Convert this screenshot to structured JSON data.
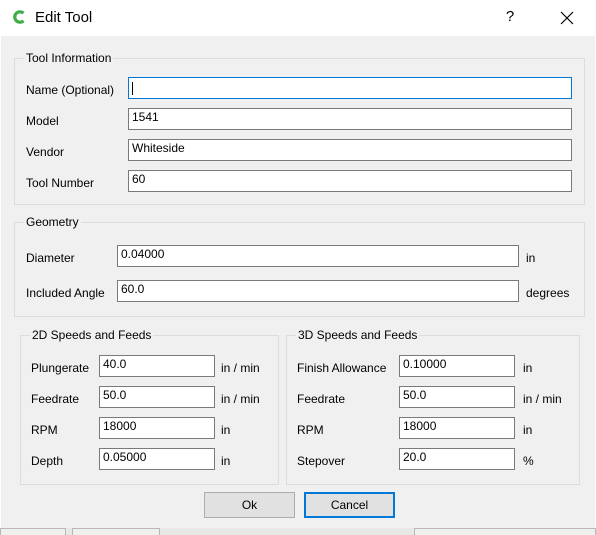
{
  "window": {
    "title": "Edit Tool",
    "help_label": "?",
    "icons": {
      "app": "app-logo-icon",
      "close": "close-icon"
    }
  },
  "tool_info": {
    "title": "Tool Information",
    "name_label": "Name (Optional)",
    "name_value": "",
    "model_label": "Model",
    "model_value": "1541",
    "vendor_label": "Vendor",
    "vendor_value": "Whiteside",
    "number_label": "Tool Number",
    "number_value": "60"
  },
  "geometry": {
    "title": "Geometry",
    "diameter_label": "Diameter",
    "diameter_value": "0.04000",
    "diameter_unit": "in",
    "angle_label": "Included Angle",
    "angle_value": "60.0",
    "angle_unit": "degrees"
  },
  "speeds_2d": {
    "title": "2D Speeds and Feeds",
    "plungerate_label": "Plungerate",
    "plungerate_value": "40.0",
    "plungerate_unit": "in / min",
    "feedrate_label": "Feedrate",
    "feedrate_value": "50.0",
    "feedrate_unit": "in / min",
    "rpm_label": "RPM",
    "rpm_value": "18000",
    "rpm_unit": "in",
    "depth_label": "Depth",
    "depth_value": "0.05000",
    "depth_unit": "in"
  },
  "speeds_3d": {
    "title": "3D Speeds and Feeds",
    "finish_label": "Finish Allowance",
    "finish_value": "0.10000",
    "finish_unit": "in",
    "feedrate_label": "Feedrate",
    "feedrate_value": "50.0",
    "feedrate_unit": "in / min",
    "rpm_label": "RPM",
    "rpm_value": "18000",
    "rpm_unit": "in",
    "stepover_label": "Stepover",
    "stepover_value": "20.0",
    "stepover_unit": "%"
  },
  "buttons": {
    "ok": "Ok",
    "cancel": "Cancel"
  },
  "colors": {
    "accent": "#0078d7",
    "logo_green": "#3fae49",
    "dialog_bg": "#f0f0f0"
  }
}
